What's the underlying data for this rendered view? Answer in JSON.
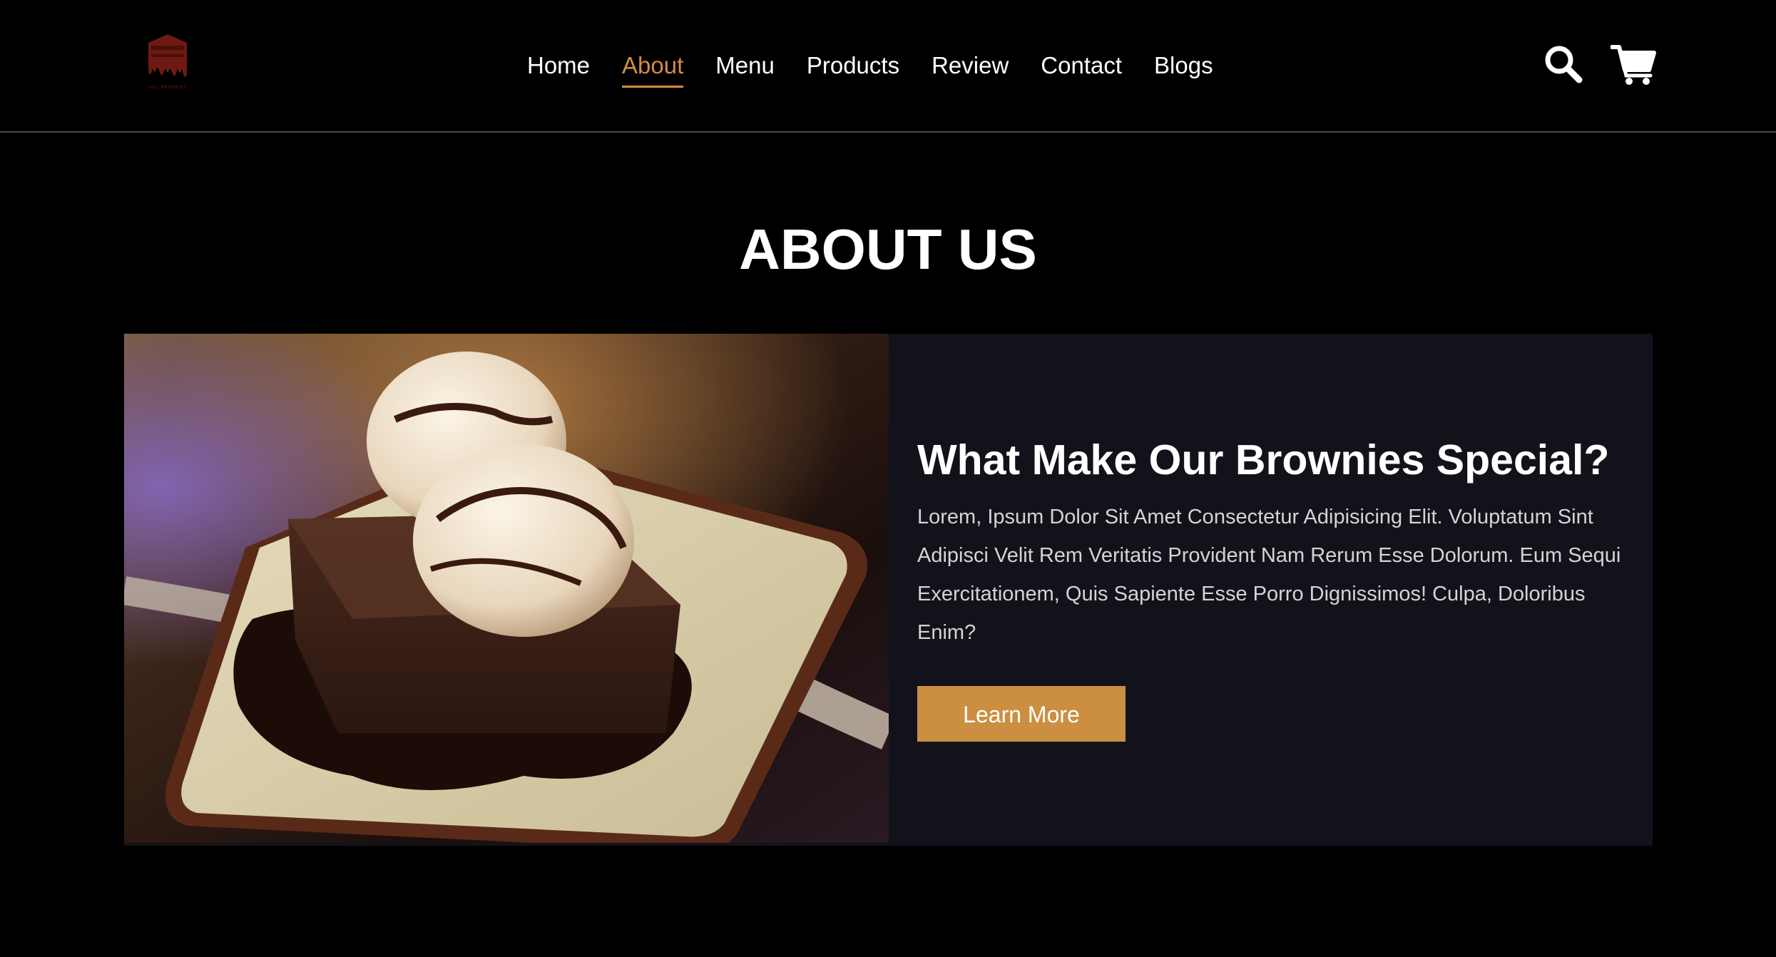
{
  "header": {
    "logo_text": "LALL BROWNIES",
    "search_icon": "search-icon",
    "cart_icon": "shopping-cart-icon",
    "nav": {
      "active": "About",
      "items": [
        {
          "label": "Home"
        },
        {
          "label": "About"
        },
        {
          "label": "Menu"
        },
        {
          "label": "Products"
        },
        {
          "label": "Review"
        },
        {
          "label": "Contact"
        },
        {
          "label": "Blogs"
        }
      ]
    }
  },
  "about": {
    "title": "ABOUT US",
    "heading": "What Make Our Brownies Special?",
    "text": "Lorem, Ipsum Dolor Sit Amet Consectetur Adipisicing Elit. Voluptatum Sint Adipisci Velit Rem Veritatis Provident Nam Rerum Esse Dolorum. Eum Sequi Exercitationem, Quis Sapiente Esse Porro Dignissimos! Culpa, Doloribus Enim?",
    "button_label": "Learn More",
    "image": "brownie-with-ice-cream-photo"
  },
  "colors": {
    "background": "#000000",
    "accent": "#d48c42",
    "button": "#cc8f41",
    "card": "#12131a",
    "logo": "#6e1a12"
  }
}
